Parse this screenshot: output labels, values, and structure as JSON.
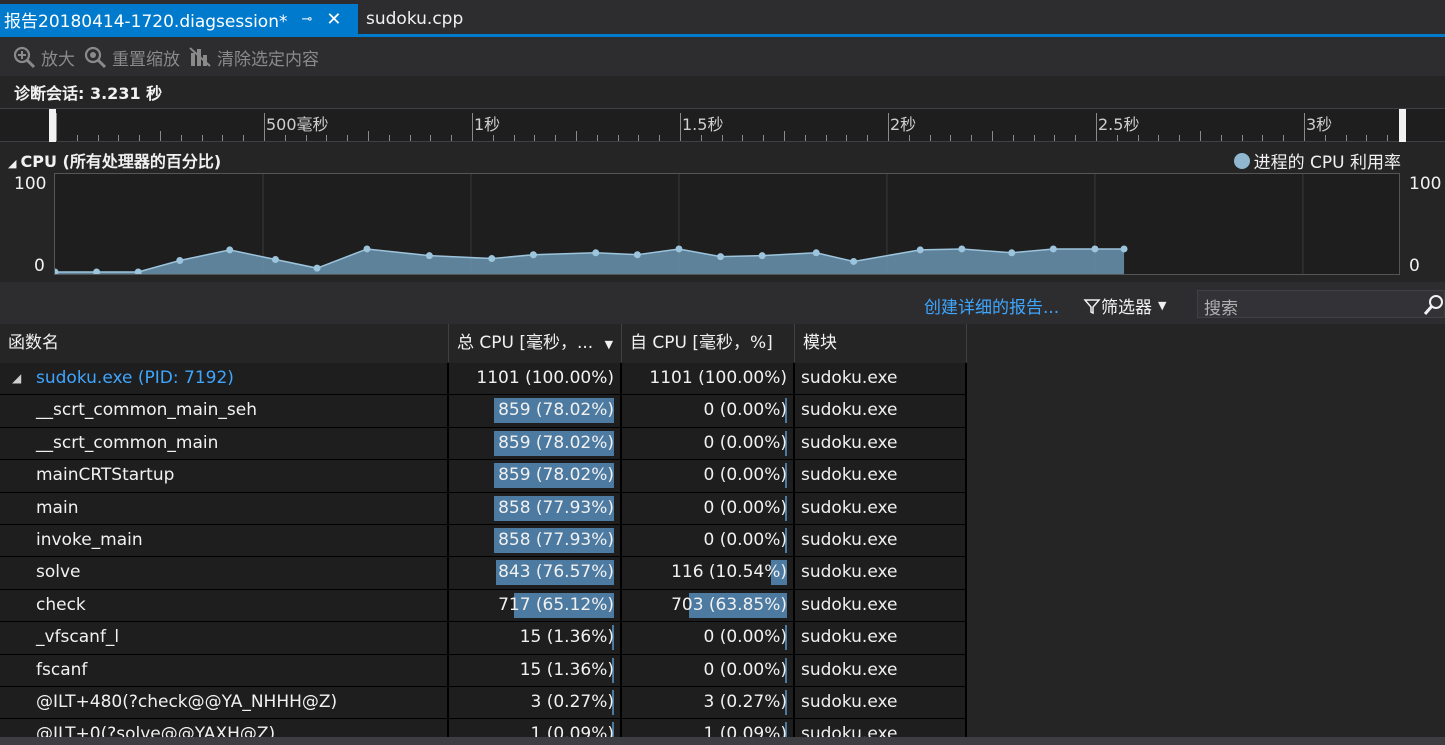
{
  "tabs": {
    "active_title": "报告20180414-1720.diagsession*",
    "pin_glyph": "⊸",
    "close_glyph": "✕",
    "inactive_title": "sudoku.cpp"
  },
  "toolbar": {
    "zoom_in_label": "放大",
    "reset_zoom_label": "重置缩放",
    "clear_selection_label": "清除选定内容"
  },
  "session": {
    "label": "诊断会话: 3.231 秒"
  },
  "ruler": {
    "labels": [
      "500毫秒",
      "1秒",
      "1.5秒",
      "2秒",
      "2.5秒",
      "3秒"
    ]
  },
  "cpu": {
    "title": "CPU (所有处理器的百分比)",
    "legend": "进程的 CPU 利用率",
    "y_max_label": "100",
    "y_min_label": "0",
    "y_max_label_right": "100",
    "y_min_label_right": "0"
  },
  "chart_data": {
    "type": "area",
    "title": "CPU (所有处理器的百分比)",
    "series": [
      {
        "name": "进程的 CPU 利用率",
        "x_seconds": [
          0.0,
          0.1,
          0.2,
          0.3,
          0.42,
          0.53,
          0.63,
          0.75,
          0.9,
          1.05,
          1.15,
          1.3,
          1.4,
          1.5,
          1.6,
          1.7,
          1.83,
          1.92,
          2.08,
          2.18,
          2.3,
          2.4,
          2.5,
          2.57
        ],
        "values": [
          0,
          0,
          0,
          12,
          23,
          13,
          4,
          24,
          17,
          14,
          18,
          20,
          18,
          24,
          16,
          17,
          20,
          11,
          23,
          24,
          20,
          24,
          24,
          24
        ]
      }
    ],
    "ylim": [
      0,
      100
    ],
    "xlim_seconds": [
      0,
      3.231
    ]
  },
  "filterbar": {
    "report_link": "创建详细的报告...",
    "filter_label": "筛选器",
    "search_placeholder": "搜索"
  },
  "grid": {
    "headers": {
      "name": "函数名",
      "total": "总 CPU [毫秒，...",
      "self": "自 CPU [毫秒，%]",
      "module": "模块"
    },
    "rows": [
      {
        "name": "sudoku.exe (PID: 7192)",
        "total": "1101 (100.00%)",
        "total_pct": 100.0,
        "self": "1101 (100.00%)",
        "self_pct": 100.0,
        "module": "sudoku.exe"
      },
      {
        "name": "__scrt_common_main_seh",
        "total": "859 (78.02%)",
        "total_pct": 78.02,
        "self": "0 (0.00%)",
        "self_pct": 0.0,
        "module": "sudoku.exe"
      },
      {
        "name": "__scrt_common_main",
        "total": "859 (78.02%)",
        "total_pct": 78.02,
        "self": "0 (0.00%)",
        "self_pct": 0.0,
        "module": "sudoku.exe"
      },
      {
        "name": "mainCRTStartup",
        "total": "859 (78.02%)",
        "total_pct": 78.02,
        "self": "0 (0.00%)",
        "self_pct": 0.0,
        "module": "sudoku.exe"
      },
      {
        "name": "main",
        "total": "858 (77.93%)",
        "total_pct": 77.93,
        "self": "0 (0.00%)",
        "self_pct": 0.0,
        "module": "sudoku.exe"
      },
      {
        "name": "invoke_main",
        "total": "858 (77.93%)",
        "total_pct": 77.93,
        "self": "0 (0.00%)",
        "self_pct": 0.0,
        "module": "sudoku.exe"
      },
      {
        "name": "solve",
        "total": "843 (76.57%)",
        "total_pct": 76.57,
        "self": "116 (10.54%)",
        "self_pct": 10.54,
        "module": "sudoku.exe"
      },
      {
        "name": "check",
        "total": "717 (65.12%)",
        "total_pct": 65.12,
        "self": "703 (63.85%)",
        "self_pct": 63.85,
        "module": "sudoku.exe"
      },
      {
        "name": "_vfscanf_l",
        "total": "15 (1.36%)",
        "total_pct": 1.36,
        "self": "0 (0.00%)",
        "self_pct": 0.0,
        "module": "sudoku.exe"
      },
      {
        "name": "fscanf",
        "total": "15 (1.36%)",
        "total_pct": 1.36,
        "self": "0 (0.00%)",
        "self_pct": 0.0,
        "module": "sudoku.exe"
      },
      {
        "name": "@ILT+480(?check@@YA_NHHH@Z)",
        "total": "3 (0.27%)",
        "total_pct": 0.27,
        "self": "3 (0.27%)",
        "self_pct": 0.27,
        "module": "sudoku.exe"
      },
      {
        "name": "@ILT+0(?solve@@YAXH@Z)",
        "total": "1 (0.09%)",
        "total_pct": 0.09,
        "self": "1 (0.09%)",
        "self_pct": 0.09,
        "module": "sudoku.exe"
      }
    ]
  },
  "colors": {
    "accent": "#007acc",
    "link": "#3ea6ff",
    "bar": "#4d7aa0",
    "area": "#6a94b0"
  }
}
